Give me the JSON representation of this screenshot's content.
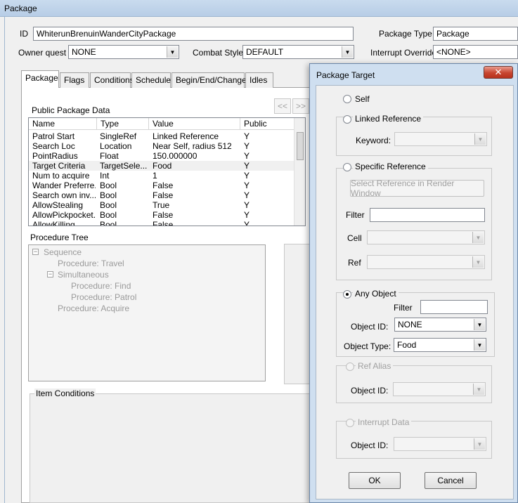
{
  "window_title": "Package",
  "id_label": "ID",
  "id_value": "WhiterunBrenuinWanderCityPackage",
  "package_type_label": "Package Type",
  "package_type_value": "Package",
  "owner_quest_label": "Owner quest",
  "owner_quest_value": "NONE",
  "combat_style_label": "Combat Style",
  "combat_style_value": "DEFAULT",
  "interrupt_override_label": "Interrupt Override",
  "interrupt_override_value": "<NONE>",
  "tabs": [
    "Package",
    "Flags",
    "Conditions",
    "Schedule",
    "Begin/End/Change",
    "Idles"
  ],
  "public_data_label": "Public Package Data",
  "nav": {
    "prev": "<<",
    "next": ">>"
  },
  "grid_headers": [
    "Name",
    "Type",
    "Value",
    "Public"
  ],
  "grid_rows": [
    [
      "Patrol Start",
      "SingleRef",
      "Linked Reference",
      "Y"
    ],
    [
      "Search Loc",
      "Location",
      "Near Self, radius 512",
      "Y"
    ],
    [
      "PointRadius",
      "Float",
      "150.000000",
      "Y"
    ],
    [
      "Target Criteria",
      "TargetSele...",
      "Food",
      "Y"
    ],
    [
      "Num to acquire",
      "Int",
      "1",
      "Y"
    ],
    [
      "Wander Preferre...",
      "Bool",
      "False",
      "Y"
    ],
    [
      "Search own inv...",
      "Bool",
      "False",
      "Y"
    ],
    [
      "AllowStealing",
      "Bool",
      "True",
      "Y"
    ],
    [
      "AllowPickpocket...",
      "Bool",
      "False",
      "Y"
    ],
    [
      "AllowKilling",
      "Bool",
      "False",
      "Y"
    ]
  ],
  "procedure_tree_label": "Procedure Tree",
  "tree_nodes": [
    "Sequence",
    "Procedure: Travel",
    "Simultaneous",
    "Procedure: Find",
    "Procedure: Patrol",
    "Procedure: Acquire"
  ],
  "item_conditions_label": "Item Conditions",
  "dialog": {
    "title": "Package Target",
    "close": "✕",
    "self_label": "Self",
    "linked_ref_label": "Linked Reference",
    "keyword_label": "Keyword:",
    "specific_ref_label": "Specific Reference",
    "select_ref_button": "Select Reference in Render Window",
    "filter_label": "Filter",
    "cell_label": "Cell",
    "ref_label": "Ref",
    "any_object_label": "Any Object",
    "any_filter_label": "Filter",
    "object_id_label": "Object ID:",
    "object_id_value": "NONE",
    "object_type_label": "Object Type:",
    "object_type_value": "Food",
    "ref_alias_label": "Ref Alias",
    "ref_alias_object_id_label": "Object ID:",
    "interrupt_data_label": "Interrupt Data",
    "interrupt_object_id_label": "Object ID:",
    "ok": "OK",
    "cancel": "Cancel"
  }
}
